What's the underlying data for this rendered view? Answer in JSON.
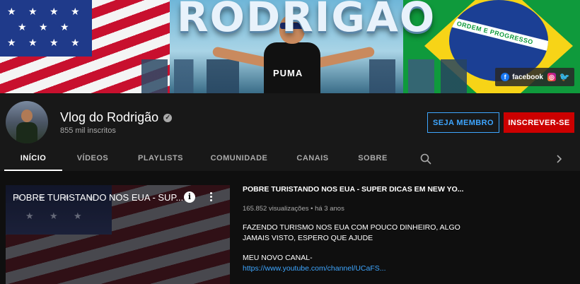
{
  "banner": {
    "title": "RODRIGÃO",
    "shirt_logo": "PUMA",
    "flag_motto": "ORDEM E PROGRESSO",
    "socials": [
      {
        "name": "facebook",
        "label": "facebook",
        "color": "#1877f2"
      },
      {
        "name": "instagram",
        "label": "",
        "color": "#e91e63"
      },
      {
        "name": "twitter",
        "label": "",
        "color": "#1da1f2"
      }
    ]
  },
  "channel": {
    "name": "Vlog do Rodrigão",
    "subscribers": "855 mil inscritos",
    "member_button": "SEJA MEMBRO",
    "subscribe_button": "INSCREVER-SE"
  },
  "tabs": [
    "INÍCIO",
    "VÍDEOS",
    "PLAYLISTS",
    "COMUNIDADE",
    "CANAIS",
    "SOBRE"
  ],
  "active_tab": "INÍCIO",
  "featured": {
    "thumb_title": "POBRE TURISTANDO NOS EUA - SUP...",
    "title": "POBRE TURISTANDO NOS EUA - SUPER DICAS  EM NEW YO...",
    "views": "165.852 visualizações",
    "age": "há 3 anos",
    "description_line1": "FAZENDO TURISMO NOS EUA COM POUCO DINHEIRO, ALGO",
    "description_line2": "JAMAIS VISTO, ESPERO QUE AJUDE",
    "new_channel_label": "MEU NOVO CANAL-",
    "link": "https://www.youtube.com/channel/UCaFS..."
  },
  "colors": {
    "background": "#181818",
    "content_bg": "#0f0f0f",
    "accent_blue": "#3ea6ff",
    "subscribe_red": "#cc0000"
  }
}
